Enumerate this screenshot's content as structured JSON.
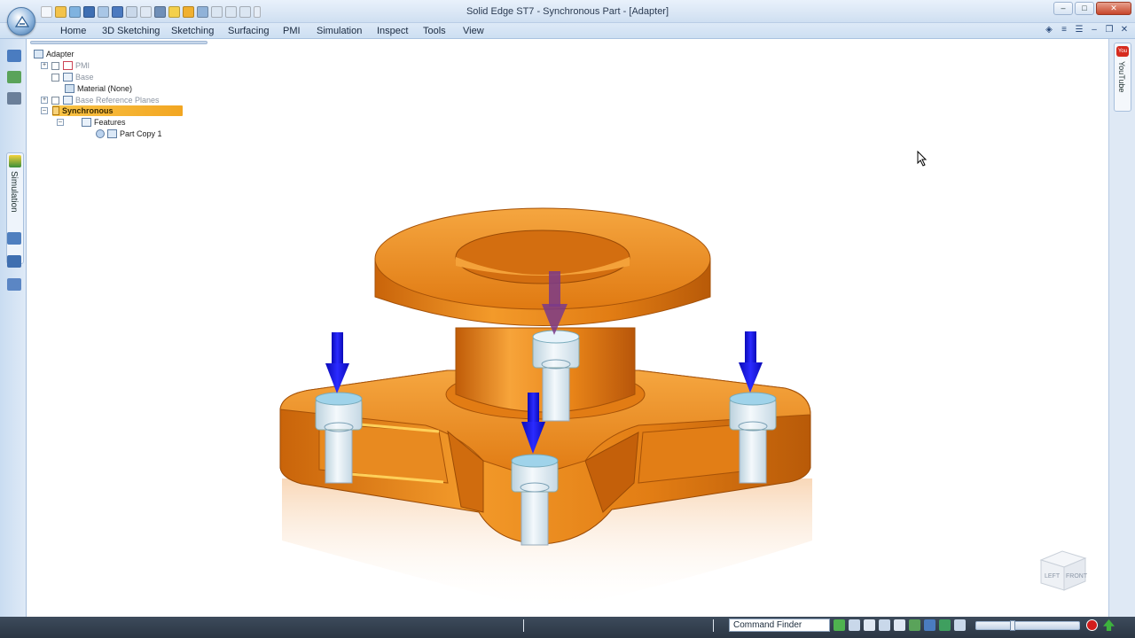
{
  "window": {
    "title": "Solid Edge ST7 - Synchronous Part - [Adapter]",
    "controls": [
      "–",
      "□",
      "✕"
    ]
  },
  "ribbon": {
    "tabs": [
      "Home",
      "3D Sketching",
      "Sketching",
      "Surfacing",
      "PMI",
      "Simulation",
      "Inspect",
      "Tools",
      "View"
    ]
  },
  "sidebar": {
    "simulation_label": "Simulation"
  },
  "rightbar": {
    "youtube_label": "YouTube",
    "youtube_logo": "You Tube"
  },
  "tree": {
    "root": "Adapter",
    "items": [
      {
        "label": "PMI",
        "dimmed": true
      },
      {
        "label": "Base",
        "dimmed": true
      },
      {
        "label": "Material (None)",
        "dimmed": false
      },
      {
        "label": "Base Reference Planes",
        "dimmed": true
      },
      {
        "label": "Synchronous",
        "dimmed": false
      },
      {
        "label": "Features",
        "dimmed": false
      },
      {
        "label": "Part Copy 1",
        "dimmed": false
      }
    ]
  },
  "viewcube": {
    "left": "LEFT",
    "front": "FRONT"
  },
  "statusbar": {
    "command_finder": "Command Finder"
  },
  "colors": {
    "part_orange": "#f08a1c",
    "load_arrow": "#1010d8",
    "selected_arrow": "#7a3a8a",
    "bolt": "#cfe6f2"
  }
}
